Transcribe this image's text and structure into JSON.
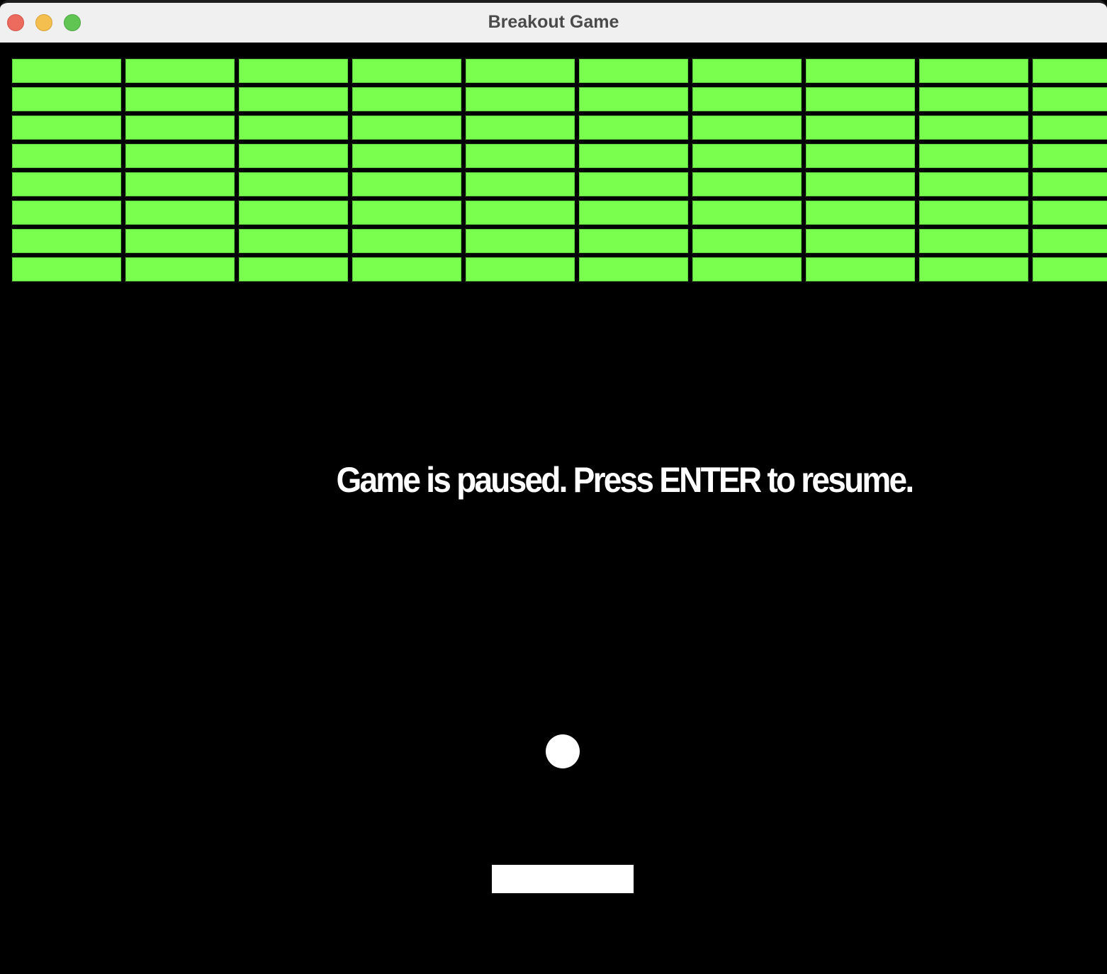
{
  "window": {
    "title": "Breakout Game"
  },
  "game": {
    "paused_message": "Game is paused. Press ENTER to resume.",
    "brick_rows": 8,
    "brick_columns_visible": 10,
    "colors": {
      "brick": "#7aff4e",
      "ball": "#ffffff",
      "paddle": "#ffffff",
      "background": "#000000"
    }
  }
}
